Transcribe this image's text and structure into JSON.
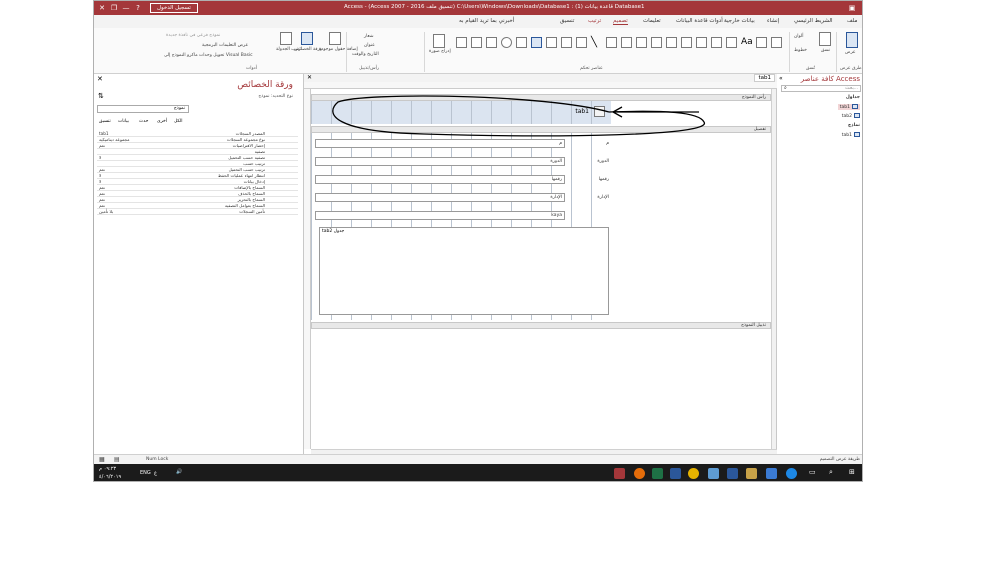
{
  "window": {
    "title": "Access - (Access 2007 - 2016 تنسيق ملف) C:\\Users\\Windows\\Downloads\\Database1 : قاعدة بيانات (1) Database1",
    "signin": "تسجيل الدخول",
    "min": "—",
    "max": "❐",
    "close": "✕",
    "help": "?"
  },
  "tabs": [
    "ملف",
    "الشريط الرئيسي",
    "إنشاء",
    "بيانات خارجية",
    "أدوات قاعدة البيانات",
    "تعليمات",
    "تصميم",
    "ترتيب",
    "تنسيق",
    "أخبرني بما تريد القيام به"
  ],
  "ribbon": {
    "views_label": "عرض",
    "views_group": "طرق عرض",
    "themes_label": "نسق",
    "themes_group": "نُسق",
    "colors": "ألوان",
    "fonts": "خطوط",
    "controls_group": "عناصر تحكم",
    "insert_image": "إدراج صورة",
    "header_footer_group": "رأس/تذييل",
    "logo": "شعار",
    "title": "عنوان",
    "date_time": "التاريخ والوقت",
    "add_fields": "إضافة حقول موجودة",
    "property_sheet": "ورقة الخصائص",
    "tab_order": "ترتيب الجدولة",
    "subform_new": "نموذج فرعي في نافذة جديدة",
    "view_code": "عرض التعليمات البرمجية",
    "convert_macros": "تحويل وحدات ماكرو النموذج إلى Visual Basic",
    "tools_group": "أدوات"
  },
  "property_sheet": {
    "title": "ورقة الخصائص",
    "selection_type": "نوع التحديد: نموذج",
    "combo_value": "نموذج",
    "tabs": [
      "الكل",
      "أخرى",
      "حدث",
      "بيانات",
      "تنسيق"
    ],
    "rows": [
      {
        "k": "المصدر السجلات",
        "v": "tab1"
      },
      {
        "k": "نوع مجموعة السجلات",
        "v": "مجموعة ديناميكية"
      },
      {
        "k": "إحضار الافتراضيات",
        "v": "نعم"
      },
      {
        "k": "تصفية",
        "v": ""
      },
      {
        "k": "تصفية حسب التحميل",
        "v": "لا"
      },
      {
        "k": "ترتيب حسب",
        "v": ""
      },
      {
        "k": "ترتيب حسب التحميل",
        "v": "نعم"
      },
      {
        "k": "انتظار انتهاء عمليات الحفظ",
        "v": "لا"
      },
      {
        "k": "إدخال بيانات",
        "v": "لا"
      },
      {
        "k": "السماح بالإضافات",
        "v": "نعم"
      },
      {
        "k": "السماح بالحذف",
        "v": "نعم"
      },
      {
        "k": "السماح بالتحرير",
        "v": "نعم"
      },
      {
        "k": "السماح بعوامل التصفية",
        "v": "نعم"
      },
      {
        "k": "تأمين السجلات",
        "v": "بلا تأمين"
      }
    ]
  },
  "document_tab": "tab1",
  "form": {
    "header_bar": "رأس النموذج",
    "header_title": "tab1",
    "detail_bar": "تفصيل",
    "footer_bar": "تذييل النموذج",
    "fields": [
      {
        "label": "م",
        "value": "م"
      },
      {
        "label": "الدورة",
        "value": "الدورة"
      },
      {
        "label": "رقمها",
        "value": "رقمها"
      },
      {
        "label": "الإدارة",
        "value": "الإدارة"
      },
      {
        "label": "",
        "value": "kaya"
      }
    ],
    "subform_label": "tab2 جدول"
  },
  "nav_pane": {
    "title": "كافة عناصر Access",
    "search_placeholder": "بحث...",
    "groups": [
      {
        "name": "جداول",
        "items": [
          "tab1",
          "tab2"
        ]
      },
      {
        "name": "نماذج",
        "items": [
          "tab1"
        ]
      }
    ]
  },
  "statusbar": {
    "left": "Num Lock",
    "right": "طريقة عرض التصميم"
  },
  "taskbar": {
    "time": "٠٩:٢٣ م",
    "date": "٤/٠٦/٢٠١٩",
    "lang": "ENG",
    "input": "ﻉ"
  },
  "colors": {
    "accent": "#a4373a",
    "ribbon_bg": "#fafafa",
    "annotation": "#000000"
  }
}
